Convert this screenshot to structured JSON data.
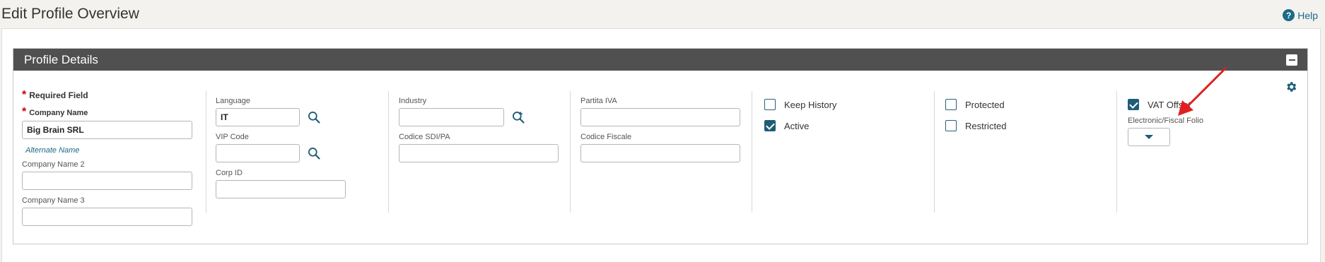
{
  "header": {
    "title": "Edit Profile Overview",
    "help_label": "Help"
  },
  "panel": {
    "title": "Profile Details"
  },
  "form": {
    "required_field_label": "Required Field",
    "company_name_label": "Company Name",
    "company_name_value": "Big Brain SRL",
    "alternate_name_link": "Alternate Name",
    "company_name2_label": "Company Name 2",
    "company_name2_value": "",
    "company_name3_label": "Company Name 3",
    "company_name3_value": "",
    "language_label": "Language",
    "language_value": "IT",
    "vip_code_label": "VIP Code",
    "vip_code_value": "",
    "corp_id_label": "Corp ID",
    "corp_id_value": "",
    "industry_label": "Industry",
    "industry_value": "",
    "codice_sdi_label": "Codice SDI/PA",
    "codice_sdi_value": "",
    "partita_iva_label": "Partita IVA",
    "partita_iva_value": "",
    "codice_fiscale_label": "Codice Fiscale",
    "codice_fiscale_value": "",
    "electronic_folio_label": "Electronic/Fiscal Folio",
    "electronic_folio_value": ""
  },
  "checkboxes": {
    "keep_history": {
      "label": "Keep History",
      "checked": false
    },
    "active": {
      "label": "Active",
      "checked": true
    },
    "protected": {
      "label": "Protected",
      "checked": false
    },
    "restricted": {
      "label": "Restricted",
      "checked": false
    },
    "vat_offset": {
      "label": "VAT Offset",
      "checked": true
    }
  },
  "colors": {
    "header_bar": "#505050",
    "accent": "#1e5d78",
    "annotation_arrow": "#e02020"
  },
  "icons": [
    "help-icon",
    "collapse-icon",
    "gear-icon",
    "search-icon",
    "search-plus-icon",
    "chevron-down-icon"
  ]
}
